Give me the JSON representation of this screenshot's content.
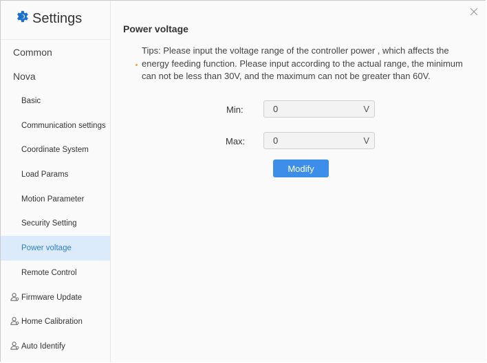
{
  "app": {
    "title": "Settings",
    "icon": "gear-icon",
    "accent_color": "#1a6fcf"
  },
  "sidebar": {
    "top_items": [
      {
        "label": "Common"
      },
      {
        "label": "Nova"
      }
    ],
    "sub_items": [
      {
        "label": "Basic"
      },
      {
        "label": "Communication settings"
      },
      {
        "label": "Coordinate System"
      },
      {
        "label": "Load Params"
      },
      {
        "label": "Motion Parameter"
      },
      {
        "label": "Security Setting"
      },
      {
        "label": "Power voltage",
        "active": true
      },
      {
        "label": "Remote Control"
      }
    ],
    "user_items": [
      {
        "label": "Firmware Update",
        "icon": "user-icon"
      },
      {
        "label": "Home Calibration",
        "icon": "user-icon"
      },
      {
        "label": "Auto Identify",
        "icon": "user-icon"
      }
    ],
    "active_color": "#dcebfb"
  },
  "main": {
    "title": "Power voltage",
    "tips": "Tips: Please input the voltage range of the controller power , which affects the energy feeding function. Please input according to the actual range, the minimum can not be less than 30V, and the maximum can not be greater than 60V.",
    "min": {
      "label": "Min:",
      "value": "0",
      "unit": "V"
    },
    "max": {
      "label": "Max:",
      "value": "0",
      "unit": "V"
    },
    "modify_label": "Modify",
    "button_color": "#3d8ee8"
  }
}
